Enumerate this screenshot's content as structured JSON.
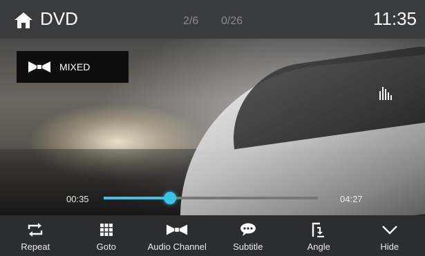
{
  "header": {
    "title": "DVD",
    "track": "2/6",
    "chapter": "0/26",
    "clock": "11:35"
  },
  "video": {
    "audio_mode": "MIXED"
  },
  "playback": {
    "current_time": "00:35",
    "total_time": "04:27",
    "progress_fraction": 0.31,
    "accent_color": "#39c3e6"
  },
  "controls": [
    {
      "label": "Repeat",
      "icon": "repeat-icon"
    },
    {
      "label": "Goto",
      "icon": "grid-icon"
    },
    {
      "label": "Audio Channel",
      "icon": "audio-channel-icon"
    },
    {
      "label": "Subtitle",
      "icon": "subtitle-icon"
    },
    {
      "label": "Angle",
      "icon": "angle-icon"
    },
    {
      "label": "Hide",
      "icon": "chevron-down-icon"
    }
  ]
}
